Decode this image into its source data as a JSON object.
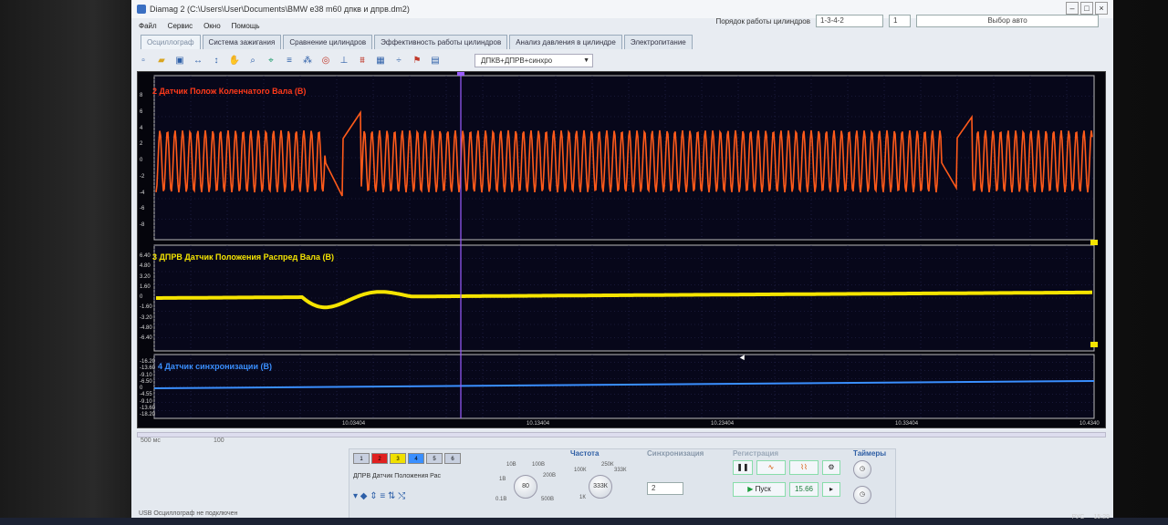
{
  "window": {
    "title": "Diamag 2 (C:\\Users\\User\\Documents\\BMW e38 m60 дпкв и дпрв.dm2)"
  },
  "menu": [
    "Файл",
    "Сервис",
    "Окно",
    "Помощь"
  ],
  "top_controls": {
    "cyl_order_label": "Порядок работы цилиндров",
    "cyl_order_value": "1-3-4-2",
    "count_value": "1",
    "auto_select": "Выбор авто"
  },
  "tabs": [
    {
      "label": "Осциллограф"
    },
    {
      "label": "Система зажигания"
    },
    {
      "label": "Сравнение цилиндров"
    },
    {
      "label": "Эффективность работы цилиндров"
    },
    {
      "label": "Анализ давления в цилиндре"
    },
    {
      "label": "Электропитание"
    }
  ],
  "toolbar": {
    "preset": "ДПКВ+ДПРВ+синхро",
    "icons": [
      "new-file-icon",
      "open-folder-icon",
      "save-icon",
      "fit-horizontal-icon",
      "fit-vertical-icon",
      "hand-icon",
      "zoom-icon",
      "marker-icon",
      "grid-icon",
      "measure-icon",
      "auto-icon",
      "zero-icon",
      "filter-icon",
      "table-icon",
      "split-icon",
      "flag-icon",
      "note-icon"
    ]
  },
  "channels": [
    {
      "title": "2 Датчик Полож Коленчатого Вала (В)",
      "color": "#ff5a1a",
      "ticks": [
        "8",
        "6",
        "4",
        "2",
        "0",
        "-2",
        "-4",
        "-6",
        "-8"
      ]
    },
    {
      "title": "3 ДПРВ Датчик Положения Распред Вала (В)",
      "color": "#f5e400",
      "ticks": [
        "6.40",
        "4.80",
        "3.20",
        "1.60",
        "0",
        "-1.60",
        "-3.20",
        "-4.80",
        "-6.40"
      ]
    },
    {
      "title": "4 Датчик синхронизации (В)",
      "color": "#3a8fff",
      "ticks": [
        "-16.20",
        "-13.60",
        "-9.10",
        "-6.50",
        "0",
        "-4.55",
        "-9.10",
        "-13.60",
        "-18.20"
      ]
    }
  ],
  "time_labels": [
    "10.03404",
    "10.13404",
    "10.23404",
    "10.33404",
    "10.4340"
  ],
  "bottom": {
    "timebase": "500 мс",
    "timebase2": "100",
    "channel_buttons": [
      "1",
      "2",
      "3",
      "4",
      "5",
      "6"
    ],
    "channel_colors": [
      "#c8d0e0",
      "#e02020",
      "#f0e000",
      "#3a8fff",
      "#c8d0e0",
      "#c8d0e0"
    ],
    "channel_select": "ДПРВ Датчик Положения Рас",
    "sections": {
      "freq": "Частота",
      "sync": "Синхронизация",
      "trigger": "Регистрация",
      "timers": "Таймеры"
    },
    "volt_knob": {
      "value": "80",
      "marks": [
        "10В",
        "100В",
        "1В",
        "200В",
        "0.1В",
        "500В"
      ]
    },
    "freq_knob": {
      "value": "333К",
      "marks": [
        "100К",
        "250К",
        "1К",
        "333К"
      ]
    },
    "sync_value": "2",
    "start_button": "Пуск",
    "rate_value": "15.66",
    "status": "USB Осциллограф не подключен"
  },
  "taskbar": {
    "lang": "РУС",
    "time": "15:29"
  }
}
